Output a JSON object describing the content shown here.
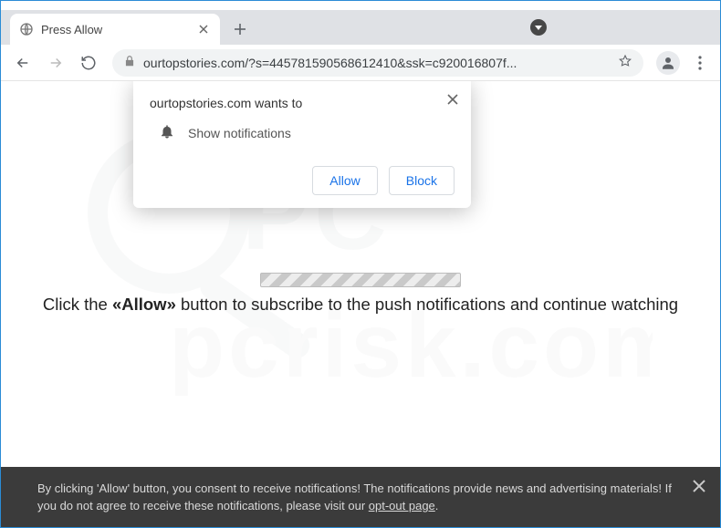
{
  "window": {
    "minimize": "−",
    "maximize": "▢",
    "close": "×"
  },
  "tab": {
    "title": "Press Allow"
  },
  "address": {
    "url": "ourtopstories.com/?s=445781590568612410&ssk=c920016807f..."
  },
  "popover": {
    "title": "ourtopstories.com wants to",
    "permission": "Show notifications",
    "allow": "Allow",
    "block": "Block"
  },
  "cta": {
    "prefix": "Click the ",
    "emph": "«Allow»",
    "suffix": " button to subscribe to the push notifications and continue watching"
  },
  "consent": {
    "text1": "By clicking 'Allow' button, you consent to receive notifications! The notifications provide news and advertising materials! If you do not agree to receive these notifications, please visit our ",
    "link": "opt-out page",
    "text2": "."
  },
  "watermark": {
    "text": "pcrisk.com"
  }
}
